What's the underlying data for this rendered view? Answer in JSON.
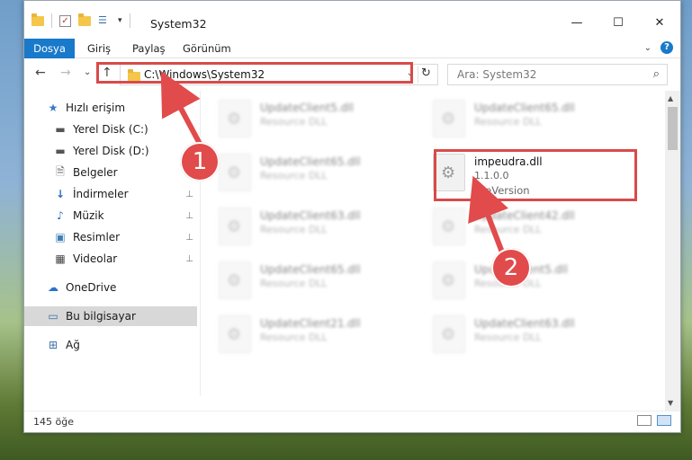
{
  "window": {
    "title": "System32",
    "min_glyph": "—",
    "max_glyph": "☐",
    "close_glyph": "✕"
  },
  "ribbon": {
    "tabs": [
      "Dosya",
      "Giriş",
      "Paylaş",
      "Görünüm"
    ],
    "help_glyph": "?",
    "collapse_glyph": "⌄"
  },
  "nav": {
    "back": "←",
    "forward": "→",
    "recent": "⌄",
    "up": "↑"
  },
  "address": {
    "path": "C:\\Windows\\System32",
    "dropdown_glyph": "⌄",
    "refresh_glyph": "↻"
  },
  "search": {
    "placeholder": "Ara: System32",
    "icon": "search-icon"
  },
  "sidebar": {
    "items": [
      {
        "label": "Hızlı erişim",
        "icon": "star-icon",
        "glyph": "★",
        "pinned": false
      },
      {
        "label": "Yerel Disk (C:)",
        "icon": "drive-icon",
        "glyph": "▬",
        "pinned": false
      },
      {
        "label": "Yerel Disk (D:)",
        "icon": "drive-icon",
        "glyph": "▬",
        "pinned": false
      },
      {
        "label": "Belgeler",
        "icon": "documents-icon",
        "glyph": "🗎",
        "pinned": true
      },
      {
        "label": "İndirmeler",
        "icon": "download-icon",
        "glyph": "↓",
        "pinned": true
      },
      {
        "label": "Müzik",
        "icon": "music-icon",
        "glyph": "♪",
        "pinned": true
      },
      {
        "label": "Resimler",
        "icon": "pictures-icon",
        "glyph": "▣",
        "pinned": true
      },
      {
        "label": "Videolar",
        "icon": "video-icon",
        "glyph": "▦",
        "pinned": true
      },
      {
        "label": "OneDrive",
        "icon": "cloud-icon",
        "glyph": "☁",
        "pinned": false
      },
      {
        "label": "Bu bilgisayar",
        "icon": "computer-icon",
        "glyph": "▭",
        "pinned": false,
        "selected": true
      },
      {
        "label": "Ağ",
        "icon": "network-icon",
        "glyph": "⊞",
        "pinned": false
      }
    ],
    "pin_glyph": "📌"
  },
  "files": [
    {
      "name": "UpdateClient5.dll",
      "desc": "Resource DLL"
    },
    {
      "name": "UpdateClient65.dll",
      "desc": "Resource DLL"
    },
    {
      "name": "UpdateClient65.dll",
      "desc": "Resource DLL"
    },
    {
      "name": "UpdateClient63.dll",
      "desc": "Resource DLL"
    },
    {
      "name": "UpdateClient42.dll",
      "desc": "Resource DLL"
    },
    {
      "name": "UpdateClient65.dll",
      "desc": "Resource DLL"
    },
    {
      "name": "UpdateClient5.dll",
      "desc": "Resource DLL"
    },
    {
      "name": "UpdateClient21.dll",
      "desc": "Resource DLL"
    },
    {
      "name": "UpdateClient63.dll",
      "desc": "Resource DLL"
    }
  ],
  "highlighted_file": {
    "name": "impeudra.dll",
    "version": "1.1.0.0",
    "desc": "FileVersion"
  },
  "status": {
    "count": "145 öğe"
  },
  "annotations": {
    "step1": "1",
    "step2": "2",
    "color": "#e14b4b"
  }
}
